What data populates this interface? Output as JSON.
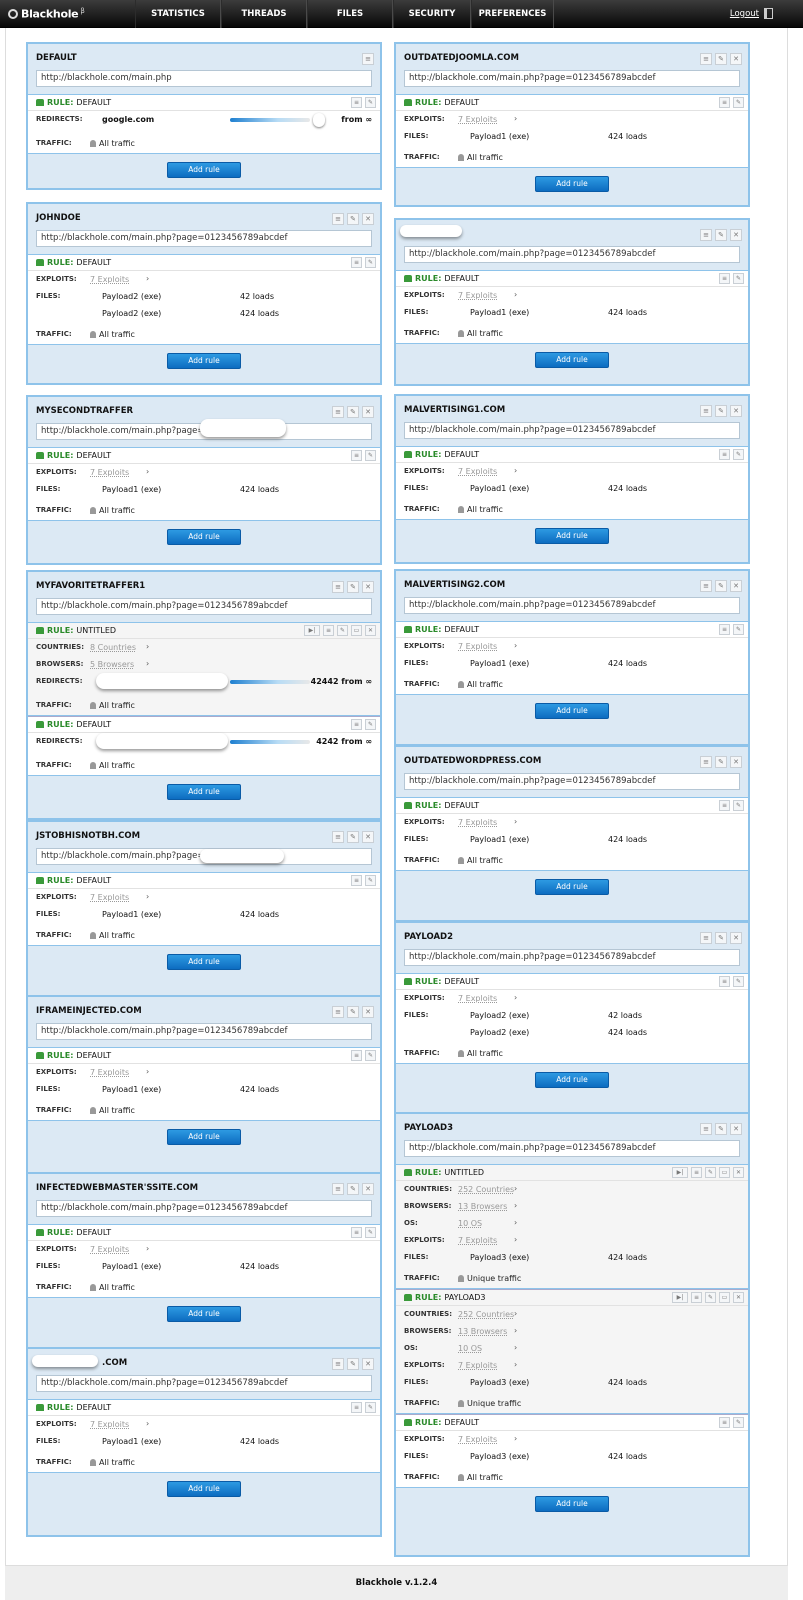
{
  "app": {
    "name": "Blackhole",
    "version_mark": "β",
    "footer": "Blackhole v.1.2.4"
  },
  "nav": [
    {
      "label": "STATISTICS"
    },
    {
      "label": "THREADS"
    },
    {
      "label": "FILES"
    },
    {
      "label": "SECURITY"
    },
    {
      "label": "PREFERENCES"
    }
  ],
  "logout_label": "Logout",
  "add_rule_label": "Add rule",
  "labels": {
    "rule": "RULE:",
    "redirects": "REDIRECTS:",
    "exploits": "EXPLOITS:",
    "files": "FILES:",
    "traffic": "TRAFFIC:",
    "countries": "COUNTRIES:",
    "browsers": "BROWSERS:",
    "os": "OS:"
  },
  "left": [
    {
      "title": "DEFAULT",
      "url": "http://blackhole.com/main.php",
      "rules": [
        {
          "name": "DEFAULT",
          "redirects": {
            "target": "google.com",
            "count": "from ∞"
          },
          "traffic": "All traffic"
        }
      ]
    },
    {
      "title": "JOHNDOE",
      "url": "http://blackhole.com/main.php?page=0123456789abcdef",
      "rules": [
        {
          "name": "DEFAULT",
          "exploits": "7 Exploits",
          "files": [
            {
              "name": "Payload2 (exe)",
              "loads": "42 loads"
            },
            {
              "name": "Payload2 (exe)",
              "loads": "424 loads"
            }
          ],
          "traffic": "All traffic"
        }
      ]
    },
    {
      "title": "MYSECONDTRAFFER",
      "url": "http://blackhole.com/main.php?page=",
      "rules": [
        {
          "name": "DEFAULT",
          "exploits": "7 Exploits",
          "files": [
            {
              "name": "Payload1 (exe)",
              "loads": "424 loads"
            }
          ],
          "traffic": "All traffic"
        }
      ]
    },
    {
      "title": "MYFAVORITETRAFFER1",
      "url": "http://blackhole.com/main.php?page=0123456789abcdef",
      "rules": [
        {
          "name": "UNTITLED",
          "countries": "8 Countries",
          "browsers": "5 Browsers",
          "redirects": {
            "target": "",
            "count": "42442 from ∞"
          },
          "traffic": "All traffic"
        },
        {
          "name": "DEFAULT",
          "redirects": {
            "target": "",
            "count": "4242 from ∞"
          },
          "traffic": "All traffic"
        }
      ]
    },
    {
      "title": "JSTOBHISNOTBH.COM",
      "url": "http://blackhole.com/main.php?page=",
      "rules": [
        {
          "name": "DEFAULT",
          "exploits": "7 Exploits",
          "files": [
            {
              "name": "Payload1 (exe)",
              "loads": "424 loads"
            }
          ],
          "traffic": "All traffic"
        }
      ]
    },
    {
      "title": "IFRAMEINJECTED.COM",
      "url": "http://blackhole.com/main.php?page=0123456789abcdef",
      "rules": [
        {
          "name": "DEFAULT",
          "exploits": "7 Exploits",
          "files": [
            {
              "name": "Payload1 (exe)",
              "loads": "424 loads"
            }
          ],
          "traffic": "All traffic"
        }
      ]
    },
    {
      "title": "INFECTEDWEBMASTER'SSITE.COM",
      "url": "http://blackhole.com/main.php?page=0123456789abcdef",
      "rules": [
        {
          "name": "DEFAULT",
          "exploits": "7 Exploits",
          "files": [
            {
              "name": "Payload1 (exe)",
              "loads": "424 loads"
            }
          ],
          "traffic": "All traffic"
        }
      ]
    },
    {
      "title": ".COM",
      "url": "http://blackhole.com/main.php?page=0123456789abcdef",
      "rules": [
        {
          "name": "DEFAULT",
          "exploits": "7 Exploits",
          "files": [
            {
              "name": "Payload1 (exe)",
              "loads": "424 loads"
            }
          ],
          "traffic": "All traffic"
        }
      ]
    }
  ],
  "right": [
    {
      "title": "OUTDATEDJOOMLA.COM",
      "url": "http://blackhole.com/main.php?page=0123456789abcdef",
      "rules": [
        {
          "name": "DEFAULT",
          "exploits": "7 Exploits",
          "files": [
            {
              "name": "Payload1 (exe)",
              "loads": "424 loads"
            }
          ],
          "traffic": "All traffic"
        }
      ]
    },
    {
      "title": "",
      "url": "http://blackhole.com/main.php?page=0123456789abcdef",
      "rules": [
        {
          "name": "DEFAULT",
          "exploits": "7 Exploits",
          "files": [
            {
              "name": "Payload1 (exe)",
              "loads": "424 loads"
            }
          ],
          "traffic": "All traffic"
        }
      ]
    },
    {
      "title": "MALVERTISING1.COM",
      "url": "http://blackhole.com/main.php?page=0123456789abcdef",
      "rules": [
        {
          "name": "DEFAULT",
          "exploits": "7 Exploits",
          "files": [
            {
              "name": "Payload1 (exe)",
              "loads": "424 loads"
            }
          ],
          "traffic": "All traffic"
        }
      ]
    },
    {
      "title": "MALVERTISING2.COM",
      "url": "http://blackhole.com/main.php?page=0123456789abcdef",
      "rules": [
        {
          "name": "DEFAULT",
          "exploits": "7 Exploits",
          "files": [
            {
              "name": "Payload1 (exe)",
              "loads": "424 loads"
            }
          ],
          "traffic": "All traffic"
        }
      ]
    },
    {
      "title": "OUTDATEDWORDPRESS.COM",
      "url": "http://blackhole.com/main.php?page=0123456789abcdef",
      "rules": [
        {
          "name": "DEFAULT",
          "exploits": "7 Exploits",
          "files": [
            {
              "name": "Payload1 (exe)",
              "loads": "424 loads"
            }
          ],
          "traffic": "All traffic"
        }
      ]
    },
    {
      "title": "PAYLOAD2",
      "url": "http://blackhole.com/main.php?page=0123456789abcdef",
      "rules": [
        {
          "name": "DEFAULT",
          "exploits": "7 Exploits",
          "files": [
            {
              "name": "Payload2 (exe)",
              "loads": "42 loads"
            },
            {
              "name": "Payload2 (exe)",
              "loads": "424 loads"
            }
          ],
          "traffic": "All traffic"
        }
      ]
    },
    {
      "title": "PAYLOAD3",
      "url": "http://blackhole.com/main.php?page=0123456789abcdef",
      "rules": [
        {
          "name": "UNTITLED",
          "countries": "252 Countries",
          "browsers": "13 Browsers",
          "os": "10 OS",
          "exploits": "7 Exploits",
          "files": [
            {
              "name": "Payload3 (exe)",
              "loads": "424 loads"
            }
          ],
          "traffic": "Unique traffic"
        },
        {
          "name": "PAYLOAD3",
          "countries": "252 Countries",
          "browsers": "13 Browsers",
          "os": "10 OS",
          "exploits": "7 Exploits",
          "files": [
            {
              "name": "Payload3 (exe)",
              "loads": "424 loads"
            }
          ],
          "traffic": "Unique traffic"
        },
        {
          "name": "DEFAULT",
          "exploits": "7 Exploits",
          "files": [
            {
              "name": "Payload3 (exe)",
              "loads": "424 loads"
            }
          ],
          "traffic": "All traffic"
        }
      ]
    }
  ]
}
